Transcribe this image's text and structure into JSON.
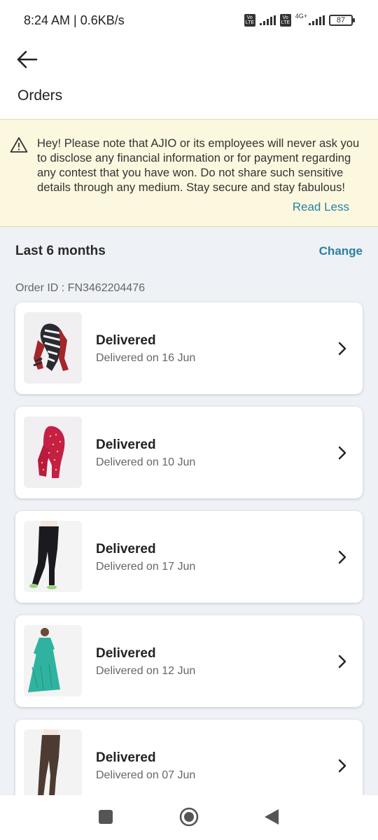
{
  "status_bar": {
    "time": "8:24 AM | 0.6KB/s",
    "volte_1": "Vo LTE",
    "volte_2": "Vo LTE",
    "network": "4G+",
    "battery": "87"
  },
  "header": {
    "title": "Orders"
  },
  "notice": {
    "text": "Hey! Please note that AJIO or its employees will never ask you\nto disclose any financial information or for payment regarding\nany contest that you have won. Do not share such sensitive\ndetails through any medium. Stay secure and stay fabulous!",
    "read_less": "Read Less"
  },
  "filter": {
    "label": "Last 6 months",
    "change": "Change"
  },
  "order_id": "Order ID : FN3462204476",
  "orders": [
    {
      "status": "Delivered",
      "date": "Delivered on 16 Jun",
      "product": "scarf-striped"
    },
    {
      "status": "Delivered",
      "date": "Delivered on 10 Jun",
      "product": "scarf-pink"
    },
    {
      "status": "Delivered",
      "date": "Delivered on 17 Jun",
      "product": "black-jeggings"
    },
    {
      "status": "Delivered",
      "date": "Delivered on 12 Jun",
      "product": "teal-kurta"
    },
    {
      "status": "Delivered",
      "date": "Delivered on 07 Jun",
      "product": "brown-leggings"
    }
  ],
  "colors": {
    "accent": "#2a7fa5",
    "notice_bg": "#fcf8df",
    "main_bg": "#eef1f5"
  },
  "icons": [
    "back-arrow-icon",
    "warning-icon",
    "chevron-right-icon",
    "recents-square-icon",
    "home-circle-icon",
    "back-triangle-icon"
  ]
}
